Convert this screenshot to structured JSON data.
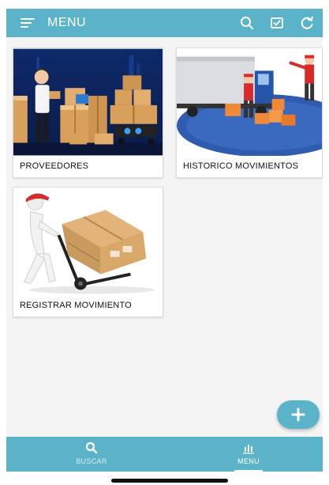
{
  "topbar": {
    "title": "MENU",
    "icons": [
      "menu-icon",
      "search-icon",
      "checkbox-icon",
      "refresh-icon"
    ]
  },
  "cards": [
    {
      "label": "PROVEEDORES",
      "image": "proveedores-illustration"
    },
    {
      "label": "HISTORICO MOVIMIENTOS",
      "image": "historico-illustration"
    },
    {
      "label": "REGISTRAR MOVIMIENTO",
      "image": "registrar-illustration"
    }
  ],
  "fab": {
    "icon": "plus-icon"
  },
  "bottom_nav": [
    {
      "label": "BUSCAR",
      "icon": "search-icon",
      "active": false
    },
    {
      "label": "MENU",
      "icon": "bar-chart-icon",
      "active": true
    }
  ],
  "colors": {
    "primary": "#5ab3c8",
    "background": "#f4f4f5",
    "card": "#ffffff"
  }
}
